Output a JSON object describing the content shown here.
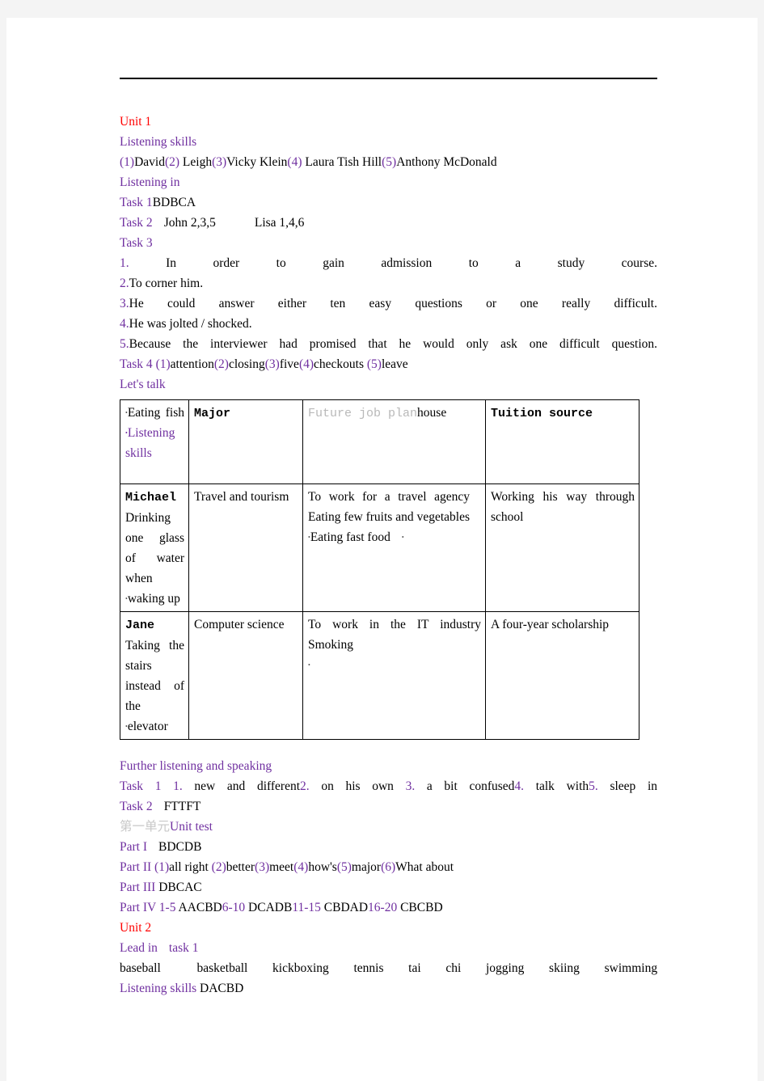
{
  "document": {
    "title": "Listening and Speaking Course Answer Key",
    "colors": {
      "heading_purple": "#7030a0",
      "unit_red": "#ff0000",
      "gray_text": "#c8c8c8",
      "body_black": "#000000"
    }
  },
  "unit1": {
    "heading": "Unit 1",
    "listening_skills_label": "Listening skills",
    "listening_skills_answers": [
      {
        "num": "(1)",
        "text": "David"
      },
      {
        "num": "(2)",
        "text": " Leigh"
      },
      {
        "num": "(3)",
        "text": "Vicky Klein"
      },
      {
        "num": "(4)",
        "text": " Laura Tish Hill"
      },
      {
        "num": "(5)",
        "text": "Anthony McDonald"
      }
    ],
    "listening_in_label": "Listening in",
    "task1_label": "Task 1",
    "task1_answer": "BDBCA",
    "task2_label": "Task 2",
    "task2_john": "John 2,3,5",
    "task2_lisa": "Lisa 1,4,6",
    "task3_label": "Task 3",
    "task3_items": [
      {
        "num": "1.",
        "text": " In order to gain admission to a study course."
      },
      {
        "num": "2.",
        "text": "To corner him."
      },
      {
        "num": "3.",
        "text": "He could answer either ten easy questions or one really difficult."
      },
      {
        "num": "4.",
        "text": "He was jolted / shocked."
      },
      {
        "num": "5.",
        "text": "Because the interviewer had promised that he would only ask one difficult question."
      }
    ],
    "task4_label": "Task 4",
    "task4_answers": [
      {
        "num": "(1)",
        "text": "attention"
      },
      {
        "num": "(2)",
        "text": "closing"
      },
      {
        "num": "(3)",
        "text": "five"
      },
      {
        "num": "(4)",
        "text": "checkouts"
      },
      {
        "num": "(5)",
        "text": "leave"
      }
    ],
    "lets_talk_label": "Let's talk"
  },
  "table": {
    "header": {
      "c1_black": "Eating fish",
      "c1_purple": "Listening skills",
      "c2": "Major",
      "c3_mono": "Future job plan",
      "c3_serif": "house",
      "c4": "Tuition source"
    },
    "rows": [
      {
        "name": "Michael",
        "habit": "Drinking one glass of water when waking up",
        "major": "Travel and tourism",
        "future_job": "To work for a travel agency",
        "habits_extra": "Eating few fruits and vegetables",
        "habits_extra2": "Eating fast food",
        "tuition": "Working his way through school"
      },
      {
        "name": "Jane",
        "habit": "Taking the stairs instead of the elevator",
        "major": "Computer science",
        "future_job": "To work in the IT industry",
        "habits_extra": "Smoking",
        "habits_extra2": "",
        "tuition": "A four-year scholarship"
      }
    ]
  },
  "further": {
    "heading": "Further listening and speaking",
    "task1_label": "Task 1",
    "task1_items": [
      {
        "num": "1.",
        "text": " new and different"
      },
      {
        "num": "2.",
        "text": " on his own "
      },
      {
        "num": "3.",
        "text": " a bit confused"
      },
      {
        "num": "4.",
        "text": " talk with"
      },
      {
        "num": "5.",
        "text": " sleep in"
      }
    ],
    "task2_label": "Task 2",
    "task2_answer": "FTTFT"
  },
  "unit_test": {
    "cn_label": "第一单元",
    "en_label": "Unit test",
    "part1_label": "Part I",
    "part1_answer": "BDCDB",
    "part2_label": "Part II",
    "part2_answers": [
      {
        "num": "(1)",
        "text": "all right "
      },
      {
        "num": "(2)",
        "text": "better"
      },
      {
        "num": "(3)",
        "text": "meet"
      },
      {
        "num": "(4)",
        "text": "how's"
      },
      {
        "num": "(5)",
        "text": "major"
      },
      {
        "num": "(6)",
        "text": "What about"
      }
    ],
    "part3_label": "Part III",
    "part3_answer": "DBCAC",
    "part4_label": "Part IV",
    "part4_groups": [
      {
        "range": "1-5",
        "answer": " AACBD"
      },
      {
        "range": "6-10",
        "answer": " DCADB"
      },
      {
        "range": "11-15",
        "answer": " CBDAD"
      },
      {
        "range": "16-20",
        "answer": " CBCBD"
      }
    ]
  },
  "unit2": {
    "heading": "Unit 2",
    "lead_in_label": "Lead in",
    "task1_label": "task 1",
    "sports": [
      "baseball",
      "basketball",
      "kickboxing",
      "tennis",
      "tai chi",
      "jogging",
      "skiing",
      "swimming"
    ],
    "listening_skills_label": "Listening skills",
    "listening_skills_answer": "DACBD"
  }
}
